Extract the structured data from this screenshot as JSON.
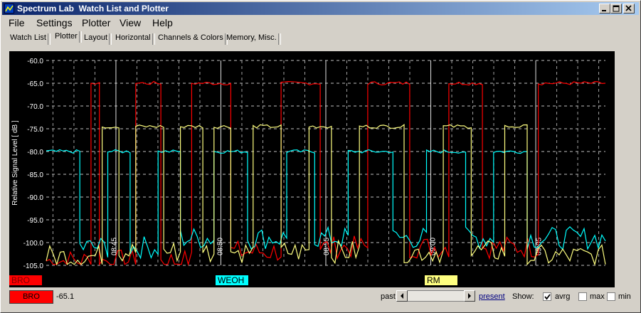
{
  "window": {
    "title": "Spectrum Lab  Watch List and Plotter",
    "buttons": [
      "minimize",
      "maximize",
      "close"
    ]
  },
  "menu": [
    "File",
    "Settings",
    "Plotter",
    "View",
    "Help"
  ],
  "tabs": [
    "Watch List",
    "Plotter",
    "Layout",
    "Horizontal",
    "Channels & Colors",
    "Memory, Misc."
  ],
  "active_tab": "Plotter",
  "channels": [
    {
      "name": "BRO",
      "color": "#ff0000"
    },
    {
      "name": "WEOH",
      "color": "#00ffff"
    },
    {
      "name": "RM",
      "color": "#ffff80"
    }
  ],
  "status": {
    "channel_name": "BRO",
    "value": "-65.1",
    "past_label": "past",
    "present_label": "present",
    "show_label": "Show:",
    "avrg_label": "avrg",
    "max_label": "max",
    "min_label": "min",
    "avrg_checked": true,
    "max_checked": false,
    "min_checked": false
  },
  "chart_data": {
    "type": "line",
    "ylabel": "Relative Signal Level [ dB ]",
    "ylim": [
      -105,
      -60
    ],
    "y_ticks": [
      "-60.0",
      "-65.0",
      "-70.0",
      "-75.0",
      "-80.0",
      "-85.0",
      "-90.0",
      "-95.0",
      "-100.0",
      "-105.0"
    ],
    "x_time_labels": [
      "08:45",
      "08:50",
      "08:55",
      "09:00",
      "09:05"
    ],
    "grid": true,
    "series": [
      {
        "name": "BRO",
        "color": "#ff0000",
        "segments": [
          [
            0.0,
            0.08,
            -104
          ],
          [
            0.08,
            0.095,
            -65
          ],
          [
            0.095,
            0.16,
            -104
          ],
          [
            0.16,
            0.205,
            -65
          ],
          [
            0.205,
            0.26,
            -104
          ],
          [
            0.26,
            0.33,
            -65
          ],
          [
            0.33,
            0.42,
            -102
          ],
          [
            0.42,
            0.49,
            -65
          ],
          [
            0.49,
            0.575,
            -101
          ],
          [
            0.575,
            0.65,
            -65
          ],
          [
            0.65,
            0.72,
            -101
          ],
          [
            0.72,
            0.78,
            -65
          ],
          [
            0.78,
            0.88,
            -101
          ],
          [
            0.88,
            1.0,
            -65
          ]
        ]
      },
      {
        "name": "WEOH",
        "color": "#00ffff",
        "segments": [
          [
            0.0,
            0.06,
            -80
          ],
          [
            0.06,
            0.11,
            -101
          ],
          [
            0.11,
            0.15,
            -80
          ],
          [
            0.15,
            0.2,
            -101
          ],
          [
            0.2,
            0.24,
            -80
          ],
          [
            0.24,
            0.3,
            -99
          ],
          [
            0.3,
            0.36,
            -80
          ],
          [
            0.36,
            0.43,
            -99
          ],
          [
            0.43,
            0.48,
            -80
          ],
          [
            0.48,
            0.54,
            -99
          ],
          [
            0.54,
            0.62,
            -80
          ],
          [
            0.62,
            0.68,
            -99
          ],
          [
            0.68,
            0.75,
            -80
          ],
          [
            0.75,
            0.8,
            -99
          ],
          [
            0.8,
            0.86,
            -80
          ],
          [
            0.86,
            1.0,
            -99
          ]
        ]
      },
      {
        "name": "RM",
        "color": "#ffff80",
        "segments": [
          [
            0.0,
            0.1,
            -103
          ],
          [
            0.1,
            0.13,
            -74.5
          ],
          [
            0.13,
            0.16,
            -102
          ],
          [
            0.16,
            0.21,
            -74.5
          ],
          [
            0.21,
            0.24,
            -102
          ],
          [
            0.24,
            0.28,
            -74.5
          ],
          [
            0.28,
            0.3,
            -102
          ],
          [
            0.3,
            0.33,
            -74.5
          ],
          [
            0.33,
            0.37,
            -102
          ],
          [
            0.37,
            0.42,
            -74.5
          ],
          [
            0.42,
            0.47,
            -102
          ],
          [
            0.47,
            0.51,
            -74.5
          ],
          [
            0.51,
            0.56,
            -102
          ],
          [
            0.56,
            0.64,
            -74.5
          ],
          [
            0.64,
            0.71,
            -102
          ],
          [
            0.71,
            0.76,
            -74.5
          ],
          [
            0.76,
            0.82,
            -102
          ],
          [
            0.82,
            0.86,
            -74.5
          ],
          [
            0.86,
            1.0,
            -103
          ]
        ]
      }
    ]
  }
}
